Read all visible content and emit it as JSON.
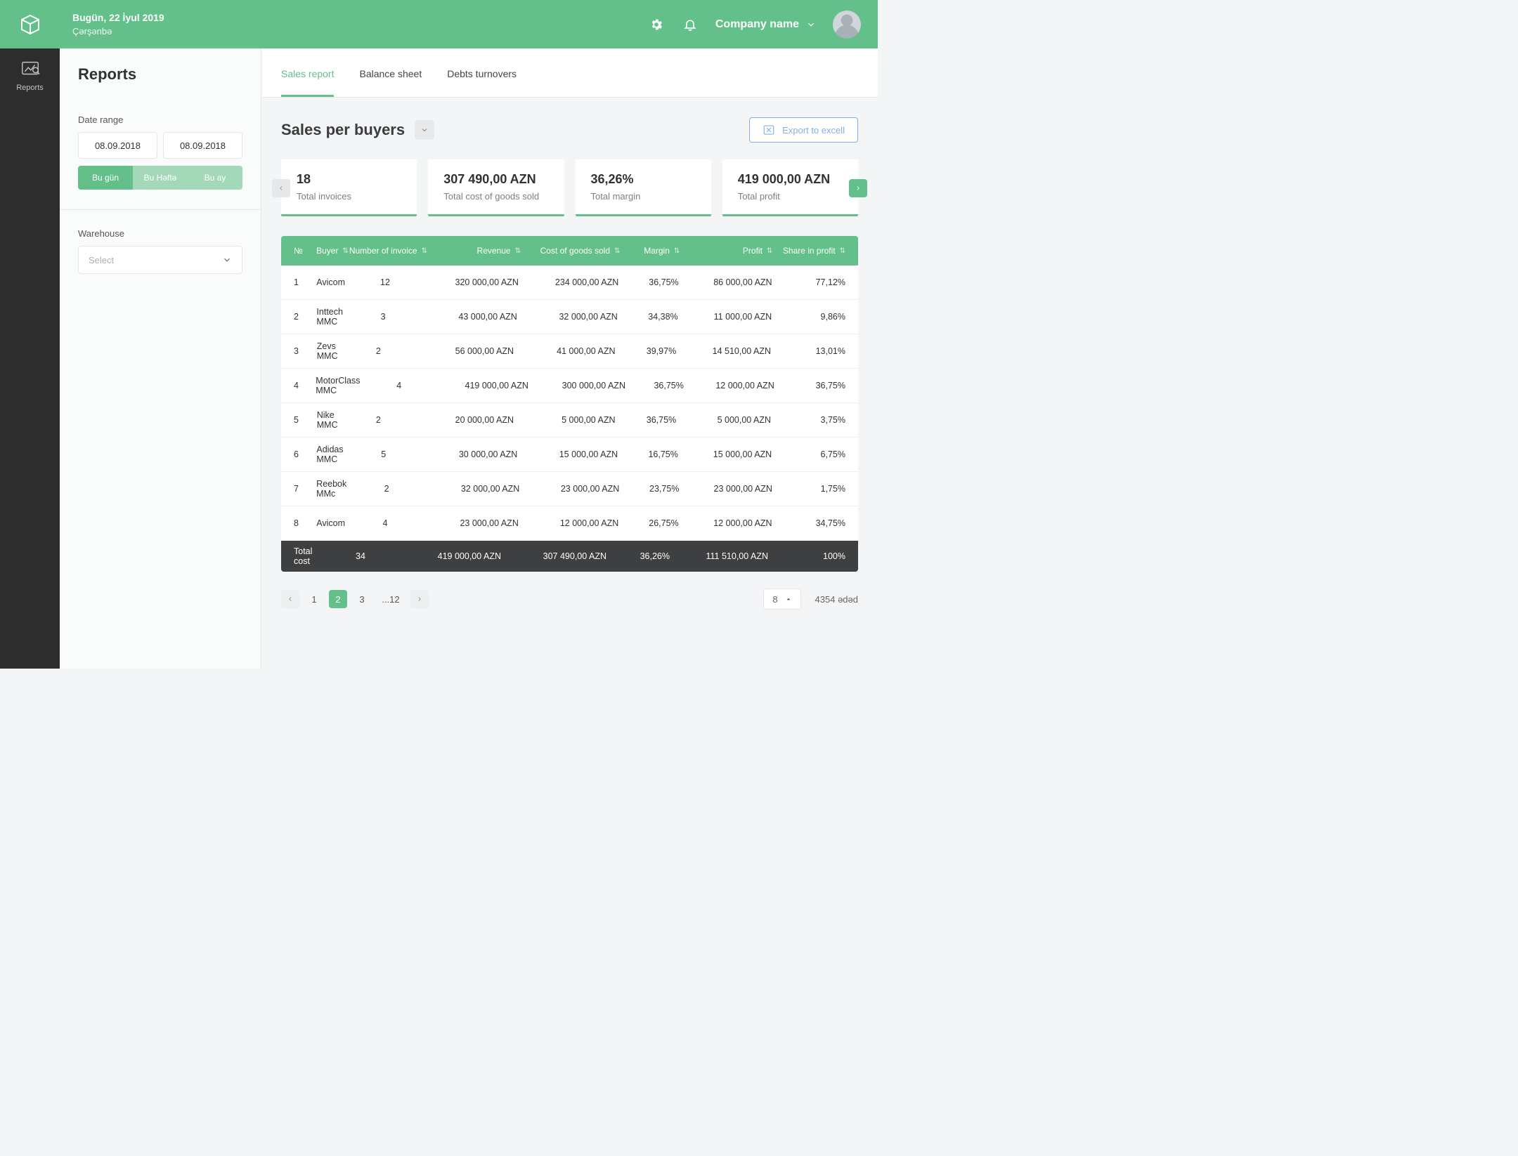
{
  "header": {
    "date_main": "Bugün, 22 İyul 2019",
    "date_sub": "Çərşənbə",
    "company": "Company name"
  },
  "nav": {
    "reports": "Reports"
  },
  "filters": {
    "title": "Reports",
    "date_label": "Date range",
    "date_from": "08.09.2018",
    "date_to": "08.09.2018",
    "range_today": "Bu gün",
    "range_week": "Bu Həftə",
    "range_month": "Bu ay",
    "warehouse_label": "Warehouse",
    "warehouse_placeholder": "Select"
  },
  "tabs": {
    "sales": "Sales report",
    "balance": "Balance sheet",
    "debts": "Debts turnovers"
  },
  "section": {
    "title": "Sales per buyers",
    "export": "Export to excell"
  },
  "metrics": [
    {
      "value": "18",
      "label": "Total invoices"
    },
    {
      "value": "307 490,00 AZN",
      "label": "Total cost of goods sold"
    },
    {
      "value": "36,26%",
      "label": "Total margin"
    },
    {
      "value": "419 000,00 AZN",
      "label": "Total profit"
    }
  ],
  "table": {
    "headers": {
      "no": "№",
      "buyer": "Buyer",
      "num": "Number of invoice",
      "revenue": "Revenue",
      "cogs": "Cost of goods sold",
      "margin": "Margin",
      "profit": "Profit",
      "share": "Share in profit"
    },
    "rows": [
      {
        "no": "1",
        "buyer": "Avicom",
        "num": "12",
        "revenue": "320 000,00 AZN",
        "cogs": "234 000,00 AZN",
        "margin": "36,75%",
        "profit": "86 000,00 AZN",
        "share": "77,12%"
      },
      {
        "no": "2",
        "buyer": "Inttech MMC",
        "num": "3",
        "revenue": "43 000,00 AZN",
        "cogs": "32 000,00 AZN",
        "margin": "34,38%",
        "profit": "11 000,00 AZN",
        "share": "9,86%"
      },
      {
        "no": "3",
        "buyer": "Zevs MMC",
        "num": "2",
        "revenue": "56 000,00 AZN",
        "cogs": "41 000,00 AZN",
        "margin": "39,97%",
        "profit": "14 510,00 AZN",
        "share": "13,01%"
      },
      {
        "no": "4",
        "buyer": "MotorClass MMC",
        "num": "4",
        "revenue": "419 000,00 AZN",
        "cogs": "300 000,00 AZN",
        "margin": "36,75%",
        "profit": "12 000,00 AZN",
        "share": "36,75%"
      },
      {
        "no": "5",
        "buyer": "Nike MMC",
        "num": "2",
        "revenue": "20 000,00 AZN",
        "cogs": "5 000,00 AZN",
        "margin": "36,75%",
        "profit": "5 000,00 AZN",
        "share": "3,75%"
      },
      {
        "no": "6",
        "buyer": "Adidas MMC",
        "num": "5",
        "revenue": "30 000,00 AZN",
        "cogs": "15 000,00 AZN",
        "margin": "16,75%",
        "profit": "15 000,00 AZN",
        "share": "6,75%"
      },
      {
        "no": "7",
        "buyer": "Reebok MMc",
        "num": "2",
        "revenue": "32 000,00 AZN",
        "cogs": "23 000,00 AZN",
        "margin": "23,75%",
        "profit": "23 000,00 AZN",
        "share": "1,75%"
      },
      {
        "no": "8",
        "buyer": "Avicom",
        "num": "4",
        "revenue": "23 000,00 AZN",
        "cogs": "12 000,00 AZN",
        "margin": "26,75%",
        "profit": "12 000,00 AZN",
        "share": "34,75%"
      }
    ],
    "footer": {
      "label": "Total cost",
      "num": "34",
      "revenue": "419 000,00 AZN",
      "cogs": "307 490,00 AZN",
      "margin": "36,26%",
      "profit": "111 510,00 AZN",
      "share": "100%"
    }
  },
  "pagination": {
    "p1": "1",
    "p2": "2",
    "p3": "3",
    "ellipsis": "...12",
    "page_size": "8",
    "total": "4354 ədəd"
  }
}
